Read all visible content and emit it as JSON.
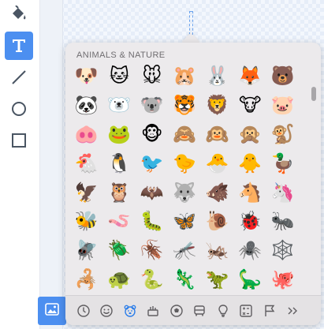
{
  "toolbar": {
    "tools": [
      {
        "name": "fill-tool",
        "icon": "paint-bucket-icon",
        "active": false
      },
      {
        "name": "text-tool",
        "icon": "text-t-icon",
        "active": true
      },
      {
        "name": "line-tool",
        "icon": "line-icon",
        "active": false
      },
      {
        "name": "circle-tool",
        "icon": "circle-icon",
        "active": false
      },
      {
        "name": "rectangle-tool",
        "icon": "square-icon",
        "active": false
      }
    ],
    "active_color": "#4c8ff0"
  },
  "bottom_button": {
    "icon": "image-icon"
  },
  "emoji_picker": {
    "category_title": "ANIMALS & NATURE",
    "rows": [
      [
        "🐶",
        "🐱",
        "🐭",
        "🐹",
        "🐰",
        "🦊",
        "🐻"
      ],
      [
        "🐼",
        "🐻‍❄️",
        "🐨",
        "🐯",
        "🦁",
        "🐮",
        "🐷"
      ],
      [
        "🐽",
        "🐸",
        "🐵",
        "🙈",
        "🙉",
        "🙊",
        "🐒"
      ],
      [
        "🐔",
        "🐧",
        "🐦",
        "🐤",
        "🐣",
        "🐥",
        "🦆"
      ],
      [
        "🦅",
        "🦉",
        "🦇",
        "🐺",
        "🐗",
        "🐴",
        "🦄"
      ],
      [
        "🐝",
        "🪱",
        "🐛",
        "🦋",
        "🐌",
        "🐞",
        "🐜"
      ],
      [
        "🪰",
        "🪲",
        "🪳",
        "🦟",
        "🦗",
        "🕷️",
        "🕸️"
      ],
      [
        "🦂",
        "🐢",
        "🐍",
        "🦎",
        "🦖",
        "🦕",
        "🐙"
      ]
    ],
    "categories": [
      {
        "name": "recent",
        "icon": "clock-icon",
        "selected": false
      },
      {
        "name": "smileys",
        "icon": "smiley-icon",
        "selected": false
      },
      {
        "name": "animals",
        "icon": "bear-icon",
        "selected": true
      },
      {
        "name": "food",
        "icon": "food-icon",
        "selected": false
      },
      {
        "name": "activity",
        "icon": "soccer-ball-icon",
        "selected": false
      },
      {
        "name": "travel",
        "icon": "car-icon",
        "selected": false
      },
      {
        "name": "objects",
        "icon": "lightbulb-icon",
        "selected": false
      },
      {
        "name": "symbols",
        "icon": "symbols-icon",
        "selected": false
      },
      {
        "name": "flags",
        "icon": "flag-icon",
        "selected": false
      },
      {
        "name": "more",
        "icon": "chevron-double-right-icon",
        "selected": false
      }
    ]
  }
}
